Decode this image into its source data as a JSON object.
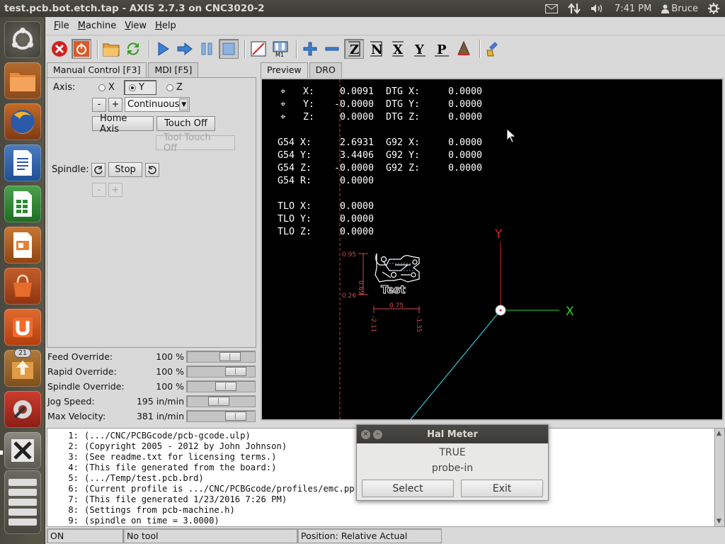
{
  "panel": {
    "window_title": "test.pcb.bot.etch.tap - AXIS 2.7.3 on CNC3020-2",
    "clock": "7:41 PM",
    "user": "Bruce"
  },
  "launcher": {
    "items": [
      "dash",
      "files",
      "firefox",
      "writer",
      "calc",
      "impress",
      "software-center",
      "ubuntu-one",
      "updates",
      "settings",
      "axis",
      "workspaces"
    ],
    "badge": "21"
  },
  "menu": [
    "File",
    "Machine",
    "View",
    "Help"
  ],
  "tabs": {
    "manual": "Manual Control [F3]",
    "mdi": "MDI [F5]",
    "preview": "Preview",
    "dro": "DRO"
  },
  "manual": {
    "axis_label": "Axis:",
    "axes": [
      "X",
      "Y",
      "Z"
    ],
    "selected_axis": "Y",
    "minus": "-",
    "plus": "+",
    "jog_mode": "Continuous",
    "home_axis": "Home Axis",
    "touch_off": "Touch Off",
    "tool_touch_off": "Tool Touch Off",
    "spindle_label": "Spindle:",
    "spindle_stop": "Stop",
    "spindle_minus": "-",
    "spindle_plus": "+"
  },
  "overrides": [
    {
      "label": "Feed Override:",
      "value": "100 %",
      "level": 0.72
    },
    {
      "label": "Rapid Override:",
      "value": "100 %",
      "level": 0.85
    },
    {
      "label": "Spindle Override:",
      "value": "100 %",
      "level": 0.62
    },
    {
      "label": "Jog Speed:",
      "value": "195 in/min",
      "level": 0.47
    },
    {
      "label": "Max Velocity:",
      "value": "381 in/min",
      "level": 0.85
    }
  ],
  "dro": {
    "rows": [
      {
        "a": "X:",
        "av": "0.0091",
        "b": "DTG X:",
        "bv": "0.0000"
      },
      {
        "a": "Y:",
        "av": "-0.0000",
        "b": "DTG Y:",
        "bv": "0.0000"
      },
      {
        "a": "Z:",
        "av": "0.0000",
        "b": "DTG Z:",
        "bv": "0.0000"
      },
      {
        "a": "G54 X:",
        "av": "2.6931",
        "b": "G92 X:",
        "bv": "0.0000"
      },
      {
        "a": "G54 Y:",
        "av": "3.4406",
        "b": "G92 Y:",
        "bv": "0.0000"
      },
      {
        "a": "G54 Z:",
        "av": "-0.0000",
        "b": "G92 Z:",
        "bv": "0.0000"
      },
      {
        "a": "G54 R:",
        "av": "0.0000",
        "b": "",
        "bv": ""
      },
      {
        "a": "TLO X:",
        "av": "0.0000",
        "b": "",
        "bv": ""
      },
      {
        "a": "TLO Y:",
        "av": "0.0000",
        "b": "",
        "bv": ""
      },
      {
        "a": "TLO Z:",
        "av": "0.0000",
        "b": "",
        "bv": ""
      }
    ],
    "axis_y_label": "Y",
    "axis_x_label": "X",
    "dims": {
      "top": "0.95",
      "height": "0.69",
      "bottom": "0.26",
      "width": "0.75",
      "left": "-2.11",
      "right": "-1.35"
    },
    "part_label": "Test"
  },
  "gcode": [
    {
      "n": "1:",
      "t": "(.../CNC/PCBGcode/pcb-gcode.ulp)"
    },
    {
      "n": "2:",
      "t": "(Copyright 2005 - 2012 by John Johnson)"
    },
    {
      "n": "3:",
      "t": "(See readme.txt for licensing terms.)"
    },
    {
      "n": "4:",
      "t": "(This file generated from the board:)"
    },
    {
      "n": "5:",
      "t": "(.../Temp/test.pcb.brd)"
    },
    {
      "n": "6:",
      "t": "(Current profile is .../CNC/PCBGcode/profiles/emc.pp"
    },
    {
      "n": "7:",
      "t": "(This file generated 1/23/2016 7:26 PM)"
    },
    {
      "n": "8:",
      "t": "(Settings from pcb-machine.h)"
    },
    {
      "n": "9:",
      "t": "(spindle on time = 3.0000)"
    }
  ],
  "status": {
    "state": "ON",
    "tool": "No tool",
    "position": "Position: Relative Actual"
  },
  "hal_meter": {
    "title": "Hal Meter",
    "value": "TRUE",
    "pin": "probe-in",
    "select": "Select",
    "exit": "Exit"
  }
}
